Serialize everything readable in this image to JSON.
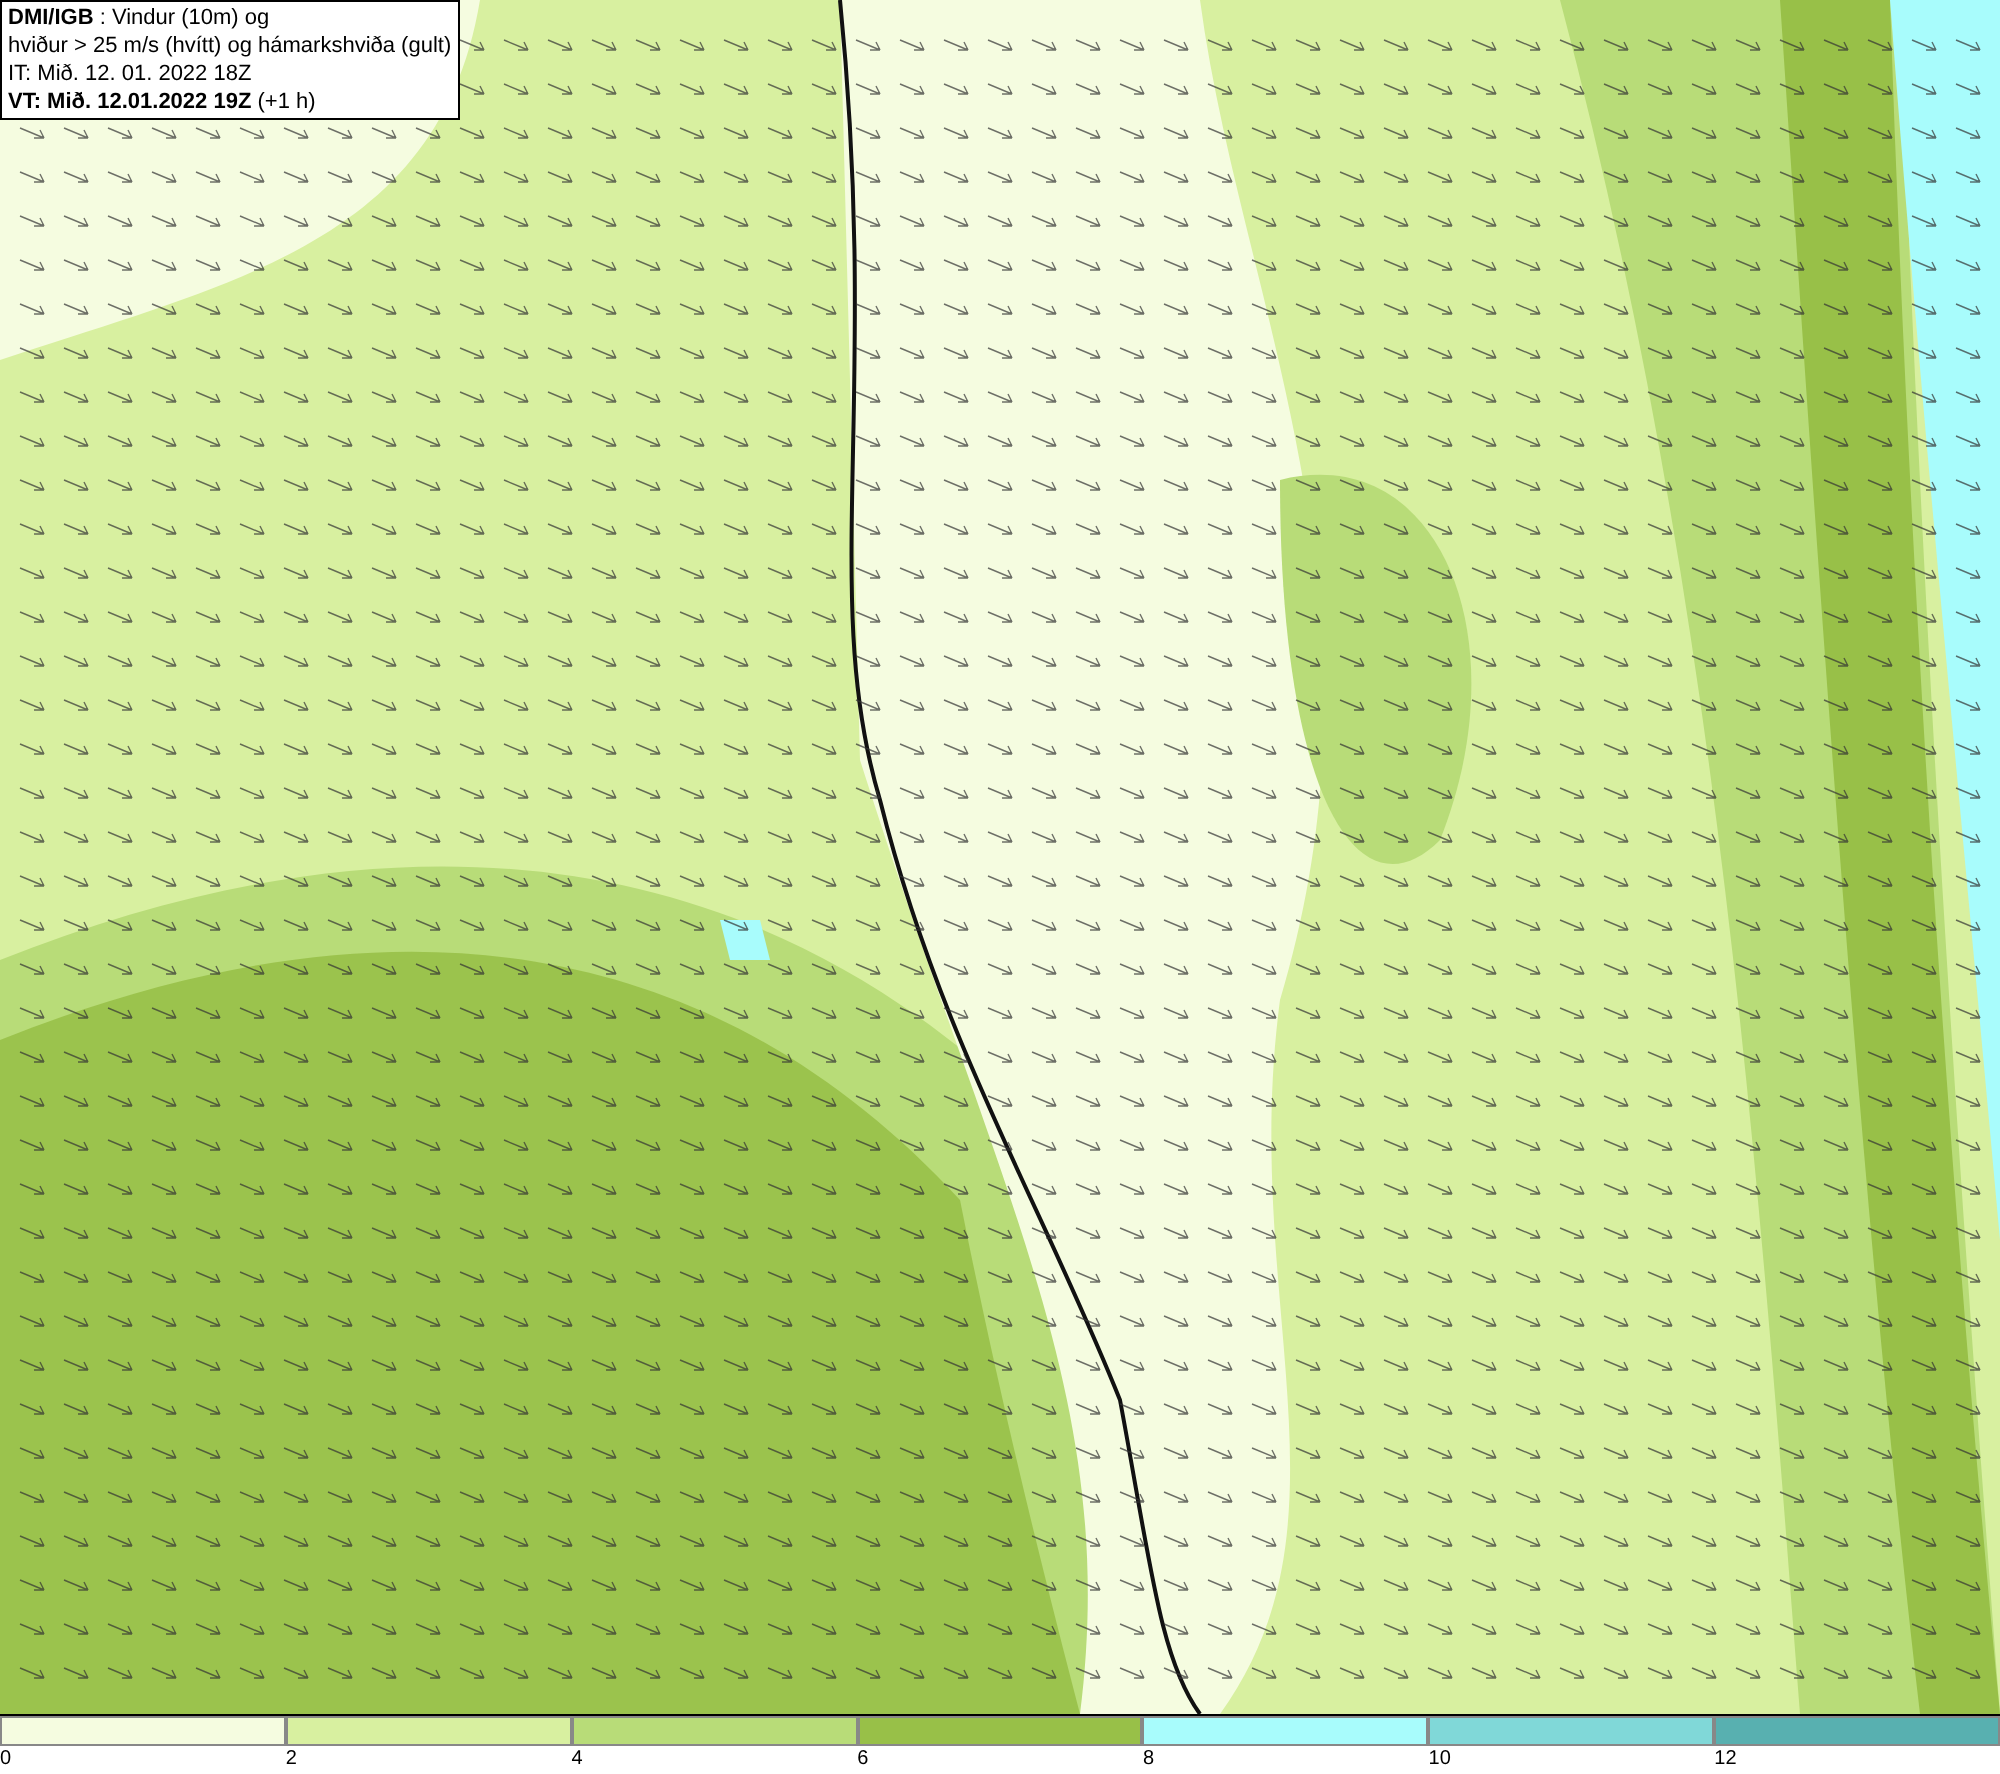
{
  "title_box": {
    "lines": [
      "**DMI/IGB** : Vindur (10m) og",
      "hviður > 25 m/s (hvítt) og hámarkshviða (gult)",
      "IT: Mið. 12. 01. 2022 18Z",
      "**VT: Mið. 12.01.2022 19Z** (+1 h)"
    ]
  },
  "legend": [
    {
      "label": "0",
      "color": "#f5fce0"
    },
    {
      "label": "2",
      "color": "#d8f0a0"
    },
    {
      "label": "4",
      "color": "#b8dc78"
    },
    {
      "label": "6",
      "color": "#98c048"
    },
    {
      "label": "8",
      "color": "#a8fcfc"
    },
    {
      "label": "10",
      "color": "#80d8d8"
    },
    {
      "label": "12",
      "color": "#58b0b0"
    }
  ]
}
